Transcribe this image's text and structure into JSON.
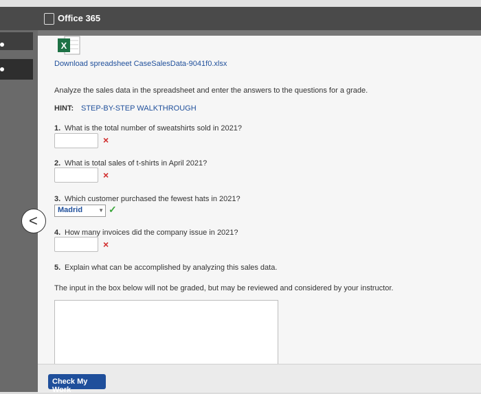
{
  "header": {
    "title": "Office 365"
  },
  "download": {
    "label": "Download spreadsheet CaseSalesData-9041f0.xlsx"
  },
  "intro": "Analyze the sales data in the spreadsheet and enter the answers to the questions for a grade.",
  "hint": {
    "label": "HINT:",
    "link": "STEP-BY-STEP WALKTHROUGH"
  },
  "questions": [
    {
      "number": "1.",
      "text": "What is the total number of sweatshirts sold in 2021?",
      "answer": "",
      "status": "×"
    },
    {
      "number": "2.",
      "text": "What is total sales of t-shirts in April 2021?",
      "answer": "",
      "status": "×"
    },
    {
      "number": "3.",
      "text": "Which customer purchased the fewest hats in 2021?",
      "answer": "Madrid",
      "status": "✓"
    },
    {
      "number": "4.",
      "text": "How many invoices did the company issue in 2021?",
      "answer": "",
      "status": "×"
    },
    {
      "number": "5.",
      "text": "Explain what can be accomplished by analyzing this sales data."
    }
  ],
  "essay_note": "The input in the box below will not be graded, but may be reviewed and considered by your instructor.",
  "check_button": "Check My Work",
  "icons": {
    "excel": "excel-file-icon",
    "back": "chevron-left-icon"
  }
}
